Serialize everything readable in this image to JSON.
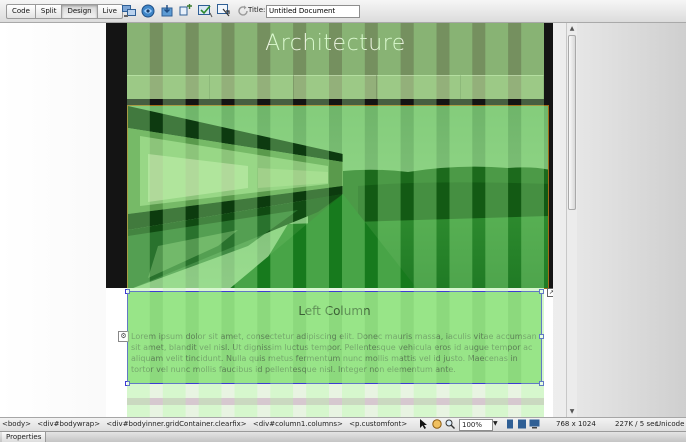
{
  "toolbar": {
    "view_buttons": [
      "Code",
      "Split",
      "Design",
      "Live"
    ],
    "active_view": "Design",
    "tool_icons": [
      "multiscreen-icon",
      "preview-icon",
      "file-management-icon",
      "visual-aids-icon",
      "check-compat-icon",
      "inspect-icon",
      "refresh-icon"
    ],
    "title_label": "Title:",
    "title_value": "Untitled Document"
  },
  "document": {
    "site_title": "Architecture",
    "left_column_title": "Left Column",
    "left_column_text": "Lorem ipsum dolor sit amet, consectetur adipiscing elit. Donec mauris massa, iaculis vitae accumsan sit amet, blandit vel nisl. Ut dignissim luctus tempor. Pellentesque vehicula eros id augue tempor ac aliquam velit tincidunt. Nulla quis metus fermentum nunc mollis mattis vel id justo. Maecenas in tortor vel nunc mollis faucibus id pellentesque nisl. Integer non elementum ante."
  },
  "statusbar": {
    "tag_selector": [
      "<body>",
      "<div#bodywrap>",
      "<div#bodyinner.gridContainer.clearfix>",
      "<div#column1.columns>",
      "<p.customfont>"
    ],
    "zoom": "100%",
    "window_size": "768 x 1024",
    "download": "227K / 5 sec",
    "encoding": "Unicode (UTF-8)"
  },
  "panel": {
    "properties_label": "Properties"
  },
  "colors": {
    "fluid_grid_column": "#b0ffa2",
    "column_fill": "#8cd97d",
    "selection_border": "#3d3ad4",
    "header_band": "#75905f"
  }
}
